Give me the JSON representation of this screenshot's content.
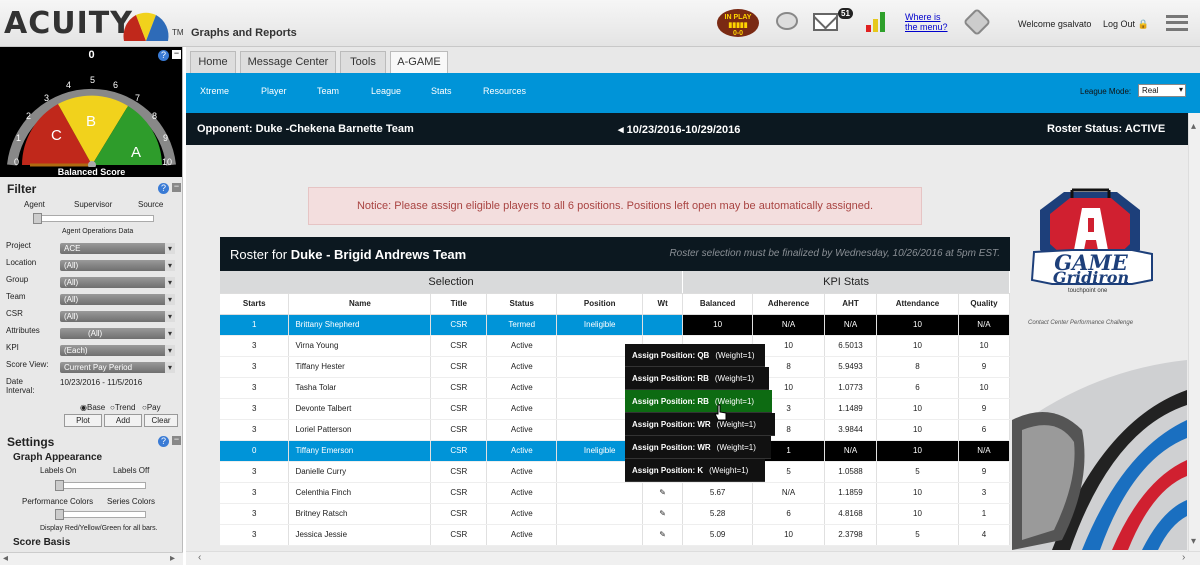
{
  "header": {
    "logo": "ACUITY",
    "tm": "TM",
    "app_title": "Graphs and Reports",
    "football": {
      "line1": "IN PLAY",
      "line2": "▮▮▮▮▮",
      "line3": "0-0"
    },
    "mail_count": "51",
    "where_link": "Where is the menu?",
    "welcome": "Welcome gsalvato",
    "logout": "Log Out"
  },
  "gauge": {
    "value": "0",
    "label": "Balanced Score",
    "ticks": [
      "0",
      "1",
      "2",
      "3",
      "4",
      "5",
      "6",
      "7",
      "8",
      "9",
      "10"
    ],
    "zones": [
      "C",
      "B",
      "A"
    ],
    "colors": {
      "c": "#c0281b",
      "b": "#f1d21c",
      "a": "#2e9c2b"
    }
  },
  "filter": {
    "title": "Filter",
    "slider_labels": [
      "Agent",
      "Supervisor",
      "Source"
    ],
    "slider_caption": "Agent Operations Data",
    "fields": [
      {
        "label": "Project",
        "value": "ACE"
      },
      {
        "label": "Location",
        "value": "(All)"
      },
      {
        "label": "Group",
        "value": "(All)"
      },
      {
        "label": "Team",
        "value": "(All)"
      },
      {
        "label": "CSR",
        "value": "(All)"
      },
      {
        "label": "Attributes",
        "value": "(All)"
      },
      {
        "label": "KPI",
        "value": "(Each)"
      },
      {
        "label": "Score View:",
        "value": "Current Pay Period"
      }
    ],
    "date_label": "Date Interval:",
    "date_value": "10/23/2016 - 11/5/2016",
    "radios": [
      "Base",
      "Trend",
      "Pay"
    ],
    "buttons": [
      "Plot",
      "Add",
      "Clear"
    ]
  },
  "settings": {
    "title": "Settings",
    "graph_appearance": "Graph Appearance",
    "labels_on": "Labels On",
    "labels_off": "Labels Off",
    "performance_colors": "Performance Colors",
    "series_colors": "Series Colors",
    "display_rule": "Display Red/Yellow/Green for all bars.",
    "score_basis": "Score Basis"
  },
  "tabs": [
    "Home",
    "Message Center",
    "Tools",
    "A-GAME"
  ],
  "subnav": [
    "Xtreme",
    "Player",
    "Team",
    "League",
    "Stats",
    "Resources"
  ],
  "league_mode": {
    "label": "League Mode:",
    "value": "Real"
  },
  "opponent_bar": {
    "opponent": "Opponent:  Duke -Chekena Barnette Team",
    "week": "◂ 10/23/2016-10/29/2016",
    "roster_status": "Roster Status:  ACTIVE"
  },
  "notice": "Notice: Please assign eligible players to all 6 positions. Positions left open may be automatically assigned.",
  "roster": {
    "title_prefix": "Roster for ",
    "team": "Duke - Brigid Andrews Team",
    "deadline": "Roster selection must be finalized by Wednesday, 10/26/2016 at 5pm EST.",
    "groups": [
      "Selection",
      "KPI Stats"
    ],
    "columns": [
      "Starts",
      "Name",
      "Title",
      "Status",
      "Position",
      "Wt",
      "Balanced",
      "Adherence",
      "AHT",
      "Attendance",
      "Quality"
    ],
    "rows": [
      {
        "starts": "1",
        "name": "Brittany Shepherd",
        "title": "CSR",
        "status": "Termed",
        "position": "Ineligible",
        "wt": "",
        "balanced": "10",
        "adherence": "N/A",
        "aht": "N/A",
        "attendance": "10",
        "quality": "N/A"
      },
      {
        "starts": "3",
        "name": "Virna Young",
        "title": "CSR",
        "status": "Active",
        "position": "",
        "wt": "",
        "balanced": "",
        "adherence": "10",
        "aht": "6.5013",
        "attendance": "10",
        "quality": "10"
      },
      {
        "starts": "3",
        "name": "Tiffany Hester",
        "title": "CSR",
        "status": "Active",
        "position": "",
        "wt": "",
        "balanced": "",
        "adherence": "8",
        "aht": "5.9493",
        "attendance": "8",
        "quality": "9"
      },
      {
        "starts": "3",
        "name": "Tasha Tolar",
        "title": "CSR",
        "status": "Active",
        "position": "",
        "wt": "",
        "balanced": "",
        "adherence": "10",
        "aht": "1.0773",
        "attendance": "6",
        "quality": "10"
      },
      {
        "starts": "3",
        "name": "Devonte Talbert",
        "title": "CSR",
        "status": "Active",
        "position": "",
        "wt": "",
        "balanced": "",
        "adherence": "3",
        "aht": "1.1489",
        "attendance": "10",
        "quality": "9"
      },
      {
        "starts": "3",
        "name": "Loriel Patterson",
        "title": "CSR",
        "status": "Active",
        "position": "",
        "wt": "",
        "balanced": "",
        "adherence": "8",
        "aht": "3.9844",
        "attendance": "10",
        "quality": "6"
      },
      {
        "starts": "0",
        "name": "Tiffany Emerson",
        "title": "CSR",
        "status": "Active",
        "position": "Ineligible",
        "wt": "",
        "balanced": "",
        "adherence": "1",
        "aht": "N/A",
        "attendance": "10",
        "quality": "N/A"
      },
      {
        "starts": "3",
        "name": "Danielle Curry",
        "title": "CSR",
        "status": "Active",
        "position": "",
        "wt": "",
        "balanced": "",
        "adherence": "5",
        "aht": "1.0588",
        "attendance": "5",
        "quality": "9"
      },
      {
        "starts": "3",
        "name": "Celenthia Finch",
        "title": "CSR",
        "status": "Active",
        "position": "",
        "wt": "✎",
        "balanced": "5.67",
        "adherence": "N/A",
        "aht": "1.1859",
        "attendance": "10",
        "quality": "3"
      },
      {
        "starts": "3",
        "name": "Britney Ratsch",
        "title": "CSR",
        "status": "Active",
        "position": "",
        "wt": "✎",
        "balanced": "5.28",
        "adherence": "6",
        "aht": "4.8168",
        "attendance": "10",
        "quality": "1"
      },
      {
        "starts": "3",
        "name": "Jessica Jessie",
        "title": "CSR",
        "status": "Active",
        "position": "",
        "wt": "✎",
        "balanced": "5.09",
        "adherence": "10",
        "aht": "2.3798",
        "attendance": "5",
        "quality": "4"
      }
    ]
  },
  "position_menu": [
    {
      "label": "Assign Position: QB",
      "weight": "(Weight=1)"
    },
    {
      "label": "Assign Position: RB",
      "weight": "(Weight=1)"
    },
    {
      "label": "Assign Position: RB",
      "weight": "(Weight=1)"
    },
    {
      "label": "Assign Position: WR",
      "weight": "(Weight=1)"
    },
    {
      "label": "Assign Position: WR",
      "weight": "(Weight=1)"
    },
    {
      "label": "Assign Position: K",
      "weight": "(Weight=1)"
    }
  ],
  "agame_logo": {
    "title": "GAME",
    "subtitle": "Gridiron",
    "brand": "touchpoint one",
    "tagline": "Contact Center Performance Challenge"
  }
}
